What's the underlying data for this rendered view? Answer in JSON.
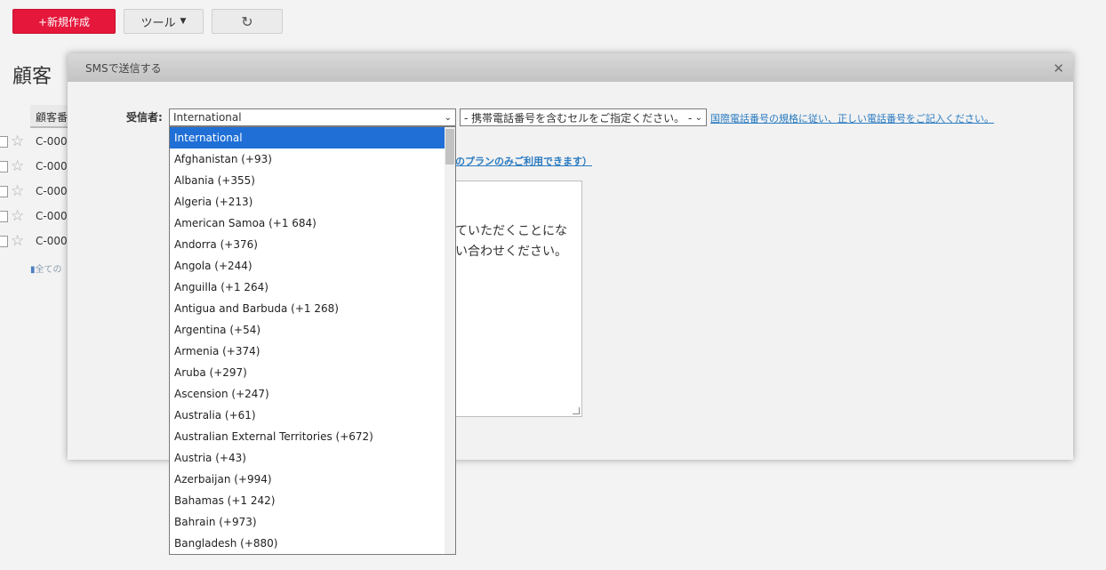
{
  "toolbar": {
    "new_label": "+新規作成",
    "tools_label": "ツール",
    "refresh_icon": "↻"
  },
  "page": {
    "title": "顧客",
    "table_header": "顧客番",
    "rows": [
      "C-000",
      "C-000",
      "C-000",
      "C-000",
      "C-000"
    ],
    "all_link": "全ての"
  },
  "modal": {
    "title": "SMSで送信する",
    "recipient_label": "受信者:",
    "country_selected": "International",
    "cell_select_placeholder": "- 携帯電話番号を含むセルをご指定ください。 -",
    "intl_link": "国際電話番号の規格に従い、正しい電話番号をご記入ください。",
    "plan_link": "のプランのみご利用できます）",
    "message_line1": "ていただくことにな",
    "message_line2": "い合わせください。"
  },
  "country_options": [
    "International",
    "Afghanistan (+93)",
    "Albania (+355)",
    "Algeria (+213)",
    "American Samoa (+1 684)",
    "Andorra (+376)",
    "Angola (+244)",
    "Anguilla (+1 264)",
    "Antigua and Barbuda (+1 268)",
    "Argentina (+54)",
    "Armenia (+374)",
    "Aruba (+297)",
    "Ascension (+247)",
    "Australia (+61)",
    "Australian External Territories (+672)",
    "Austria (+43)",
    "Azerbaijan (+994)",
    "Bahamas (+1 242)",
    "Bahrain (+973)",
    "Bangladesh (+880)"
  ],
  "colors": {
    "accent_red": "#e5173b",
    "selected_blue": "#1f6fd6",
    "link_blue": "#2a7bc1"
  }
}
